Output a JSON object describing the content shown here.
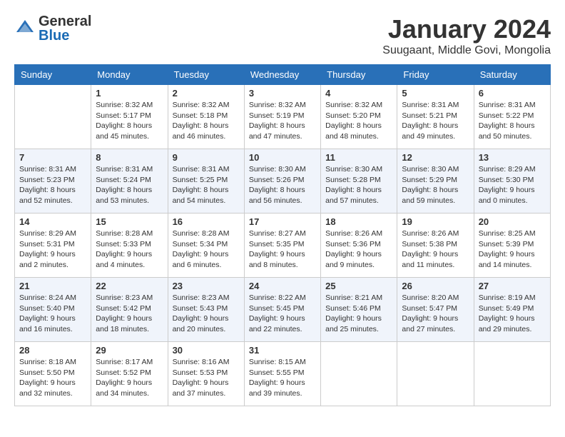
{
  "header": {
    "logo_general": "General",
    "logo_blue": "Blue",
    "month_title": "January 2024",
    "location": "Suugaant, Middle Govi, Mongolia"
  },
  "days_of_week": [
    "Sunday",
    "Monday",
    "Tuesday",
    "Wednesday",
    "Thursday",
    "Friday",
    "Saturday"
  ],
  "weeks": [
    [
      {
        "day": "",
        "info": ""
      },
      {
        "day": "1",
        "info": "Sunrise: 8:32 AM\nSunset: 5:17 PM\nDaylight: 8 hours\nand 45 minutes."
      },
      {
        "day": "2",
        "info": "Sunrise: 8:32 AM\nSunset: 5:18 PM\nDaylight: 8 hours\nand 46 minutes."
      },
      {
        "day": "3",
        "info": "Sunrise: 8:32 AM\nSunset: 5:19 PM\nDaylight: 8 hours\nand 47 minutes."
      },
      {
        "day": "4",
        "info": "Sunrise: 8:32 AM\nSunset: 5:20 PM\nDaylight: 8 hours\nand 48 minutes."
      },
      {
        "day": "5",
        "info": "Sunrise: 8:31 AM\nSunset: 5:21 PM\nDaylight: 8 hours\nand 49 minutes."
      },
      {
        "day": "6",
        "info": "Sunrise: 8:31 AM\nSunset: 5:22 PM\nDaylight: 8 hours\nand 50 minutes."
      }
    ],
    [
      {
        "day": "7",
        "info": "Sunrise: 8:31 AM\nSunset: 5:23 PM\nDaylight: 8 hours\nand 52 minutes."
      },
      {
        "day": "8",
        "info": "Sunrise: 8:31 AM\nSunset: 5:24 PM\nDaylight: 8 hours\nand 53 minutes."
      },
      {
        "day": "9",
        "info": "Sunrise: 8:31 AM\nSunset: 5:25 PM\nDaylight: 8 hours\nand 54 minutes."
      },
      {
        "day": "10",
        "info": "Sunrise: 8:30 AM\nSunset: 5:26 PM\nDaylight: 8 hours\nand 56 minutes."
      },
      {
        "day": "11",
        "info": "Sunrise: 8:30 AM\nSunset: 5:28 PM\nDaylight: 8 hours\nand 57 minutes."
      },
      {
        "day": "12",
        "info": "Sunrise: 8:30 AM\nSunset: 5:29 PM\nDaylight: 8 hours\nand 59 minutes."
      },
      {
        "day": "13",
        "info": "Sunrise: 8:29 AM\nSunset: 5:30 PM\nDaylight: 9 hours\nand 0 minutes."
      }
    ],
    [
      {
        "day": "14",
        "info": "Sunrise: 8:29 AM\nSunset: 5:31 PM\nDaylight: 9 hours\nand 2 minutes."
      },
      {
        "day": "15",
        "info": "Sunrise: 8:28 AM\nSunset: 5:33 PM\nDaylight: 9 hours\nand 4 minutes."
      },
      {
        "day": "16",
        "info": "Sunrise: 8:28 AM\nSunset: 5:34 PM\nDaylight: 9 hours\nand 6 minutes."
      },
      {
        "day": "17",
        "info": "Sunrise: 8:27 AM\nSunset: 5:35 PM\nDaylight: 9 hours\nand 8 minutes."
      },
      {
        "day": "18",
        "info": "Sunrise: 8:26 AM\nSunset: 5:36 PM\nDaylight: 9 hours\nand 9 minutes."
      },
      {
        "day": "19",
        "info": "Sunrise: 8:26 AM\nSunset: 5:38 PM\nDaylight: 9 hours\nand 11 minutes."
      },
      {
        "day": "20",
        "info": "Sunrise: 8:25 AM\nSunset: 5:39 PM\nDaylight: 9 hours\nand 14 minutes."
      }
    ],
    [
      {
        "day": "21",
        "info": "Sunrise: 8:24 AM\nSunset: 5:40 PM\nDaylight: 9 hours\nand 16 minutes."
      },
      {
        "day": "22",
        "info": "Sunrise: 8:23 AM\nSunset: 5:42 PM\nDaylight: 9 hours\nand 18 minutes."
      },
      {
        "day": "23",
        "info": "Sunrise: 8:23 AM\nSunset: 5:43 PM\nDaylight: 9 hours\nand 20 minutes."
      },
      {
        "day": "24",
        "info": "Sunrise: 8:22 AM\nSunset: 5:45 PM\nDaylight: 9 hours\nand 22 minutes."
      },
      {
        "day": "25",
        "info": "Sunrise: 8:21 AM\nSunset: 5:46 PM\nDaylight: 9 hours\nand 25 minutes."
      },
      {
        "day": "26",
        "info": "Sunrise: 8:20 AM\nSunset: 5:47 PM\nDaylight: 9 hours\nand 27 minutes."
      },
      {
        "day": "27",
        "info": "Sunrise: 8:19 AM\nSunset: 5:49 PM\nDaylight: 9 hours\nand 29 minutes."
      }
    ],
    [
      {
        "day": "28",
        "info": "Sunrise: 8:18 AM\nSunset: 5:50 PM\nDaylight: 9 hours\nand 32 minutes."
      },
      {
        "day": "29",
        "info": "Sunrise: 8:17 AM\nSunset: 5:52 PM\nDaylight: 9 hours\nand 34 minutes."
      },
      {
        "day": "30",
        "info": "Sunrise: 8:16 AM\nSunset: 5:53 PM\nDaylight: 9 hours\nand 37 minutes."
      },
      {
        "day": "31",
        "info": "Sunrise: 8:15 AM\nSunset: 5:55 PM\nDaylight: 9 hours\nand 39 minutes."
      },
      {
        "day": "",
        "info": ""
      },
      {
        "day": "",
        "info": ""
      },
      {
        "day": "",
        "info": ""
      }
    ]
  ]
}
